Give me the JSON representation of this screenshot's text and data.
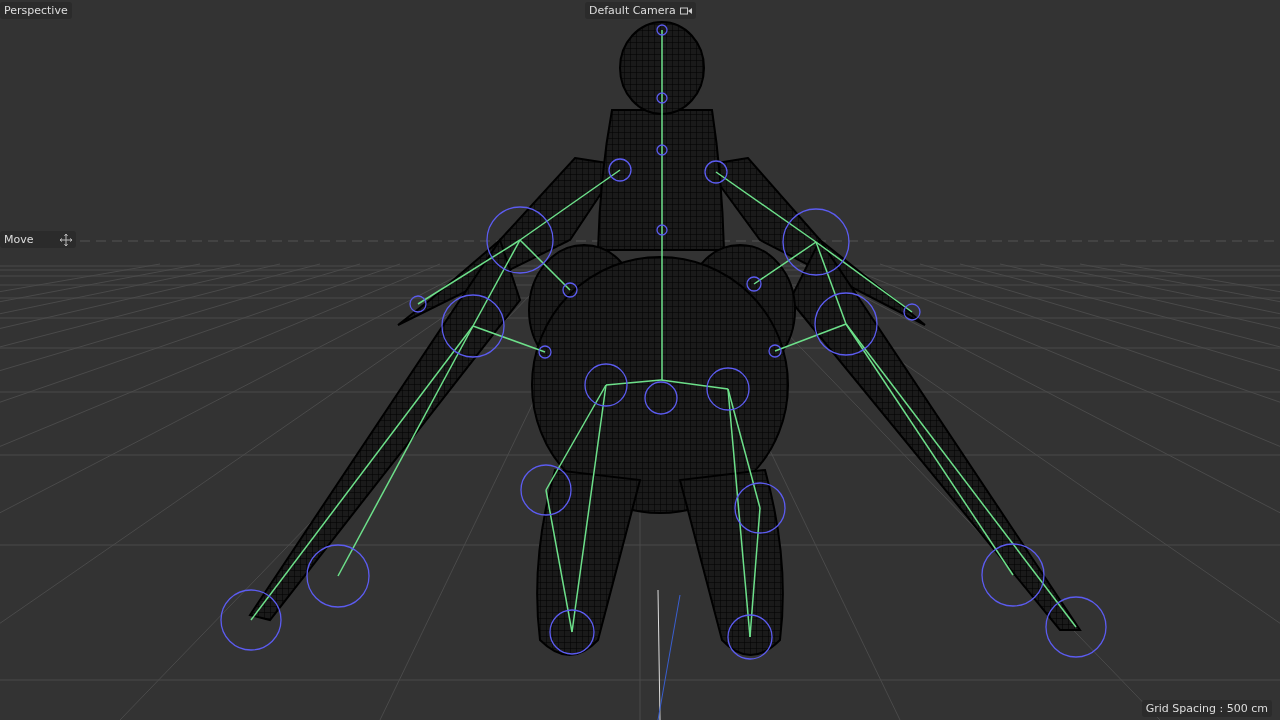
{
  "viewport": {
    "projection_label": "Perspective",
    "camera_label": "Default Camera",
    "tool_label": "Move",
    "grid_spacing": "Grid Spacing : 500 cm"
  }
}
